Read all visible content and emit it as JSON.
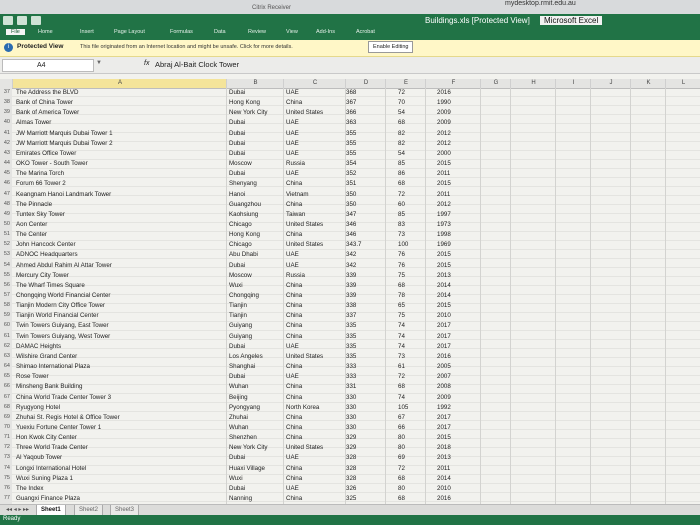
{
  "top_strip": {
    "url": "mydesktop.rmit.edu.au",
    "button": "Citrix Receiver"
  },
  "title_bar": {
    "title": "Buildings.xls [Protected View]",
    "app": "Microsoft Excel"
  },
  "ribbon_tabs": [
    "File",
    "Home",
    "Insert",
    "Page Layout",
    "Formulas",
    "Data",
    "Review",
    "View",
    "Add-Ins",
    "Acrobat"
  ],
  "protected_view": {
    "label": "Protected View",
    "message": "This file originated from an Internet location and might be unsafe. Click for more details.",
    "button": "Enable Editing"
  },
  "formula_bar": {
    "cell": "A4",
    "fx": "fx",
    "content": "Abraj Al-Bait Clock Tower"
  },
  "columns": [
    "A",
    "B",
    "C",
    "D",
    "E",
    "F",
    "G",
    "H",
    "I",
    "J",
    "K",
    "L"
  ],
  "rows": [
    {
      "n": "37",
      "name": "The Address the BLVD",
      "city": "Dubai",
      "country": "UAE",
      "height": "368",
      "floors": "72",
      "year": "2016"
    },
    {
      "n": "38",
      "name": "Bank of China Tower",
      "city": "Hong Kong",
      "country": "China",
      "height": "367",
      "floors": "70",
      "year": "1990"
    },
    {
      "n": "39",
      "name": "Bank of America Tower",
      "city": "New York City",
      "country": "United States",
      "height": "366",
      "floors": "54",
      "year": "2009"
    },
    {
      "n": "40",
      "name": "Almas Tower",
      "city": "Dubai",
      "country": "UAE",
      "height": "363",
      "floors": "68",
      "year": "2009"
    },
    {
      "n": "41",
      "name": "JW Marriott Marquis Dubai Tower 1",
      "city": "Dubai",
      "country": "UAE",
      "height": "355",
      "floors": "82",
      "year": "2012"
    },
    {
      "n": "42",
      "name": "JW Marriott Marquis Dubai Tower 2",
      "city": "Dubai",
      "country": "UAE",
      "height": "355",
      "floors": "82",
      "year": "2012"
    },
    {
      "n": "43",
      "name": "Emirates Office Tower",
      "city": "Dubai",
      "country": "UAE",
      "height": "355",
      "floors": "54",
      "year": "2000"
    },
    {
      "n": "44",
      "name": "OKO Tower - South Tower",
      "city": "Moscow",
      "country": "Russia",
      "height": "354",
      "floors": "85",
      "year": "2015"
    },
    {
      "n": "45",
      "name": "The Marina Torch",
      "city": "Dubai",
      "country": "UAE",
      "height": "352",
      "floors": "86",
      "year": "2011"
    },
    {
      "n": "46",
      "name": "Forum 66 Tower 2",
      "city": "Shenyang",
      "country": "China",
      "height": "351",
      "floors": "68",
      "year": "2015"
    },
    {
      "n": "47",
      "name": "Keangnam Hanoi Landmark Tower",
      "city": "Hanoi",
      "country": "Vietnam",
      "height": "350",
      "floors": "72",
      "year": "2011"
    },
    {
      "n": "48",
      "name": "The Pinnacle",
      "city": "Guangzhou",
      "country": "China",
      "height": "350",
      "floors": "60",
      "year": "2012"
    },
    {
      "n": "49",
      "name": "Tuntex Sky Tower",
      "city": "Kaohsiung",
      "country": "Taiwan",
      "height": "347",
      "floors": "85",
      "year": "1997"
    },
    {
      "n": "50",
      "name": "Aon Center",
      "city": "Chicago",
      "country": "United States",
      "height": "346",
      "floors": "83",
      "year": "1973"
    },
    {
      "n": "51",
      "name": "The Center",
      "city": "Hong Kong",
      "country": "China",
      "height": "346",
      "floors": "73",
      "year": "1998"
    },
    {
      "n": "52",
      "name": "John Hancock Center",
      "city": "Chicago",
      "country": "United States",
      "height": "343.7",
      "floors": "100",
      "year": "1969"
    },
    {
      "n": "53",
      "name": "ADNOC Headquarters",
      "city": "Abu Dhabi",
      "country": "UAE",
      "height": "342",
      "floors": "76",
      "year": "2015"
    },
    {
      "n": "54",
      "name": "Ahmed Abdul Rahim Al Attar Tower",
      "city": "Dubai",
      "country": "UAE",
      "height": "342",
      "floors": "76",
      "year": "2015"
    },
    {
      "n": "55",
      "name": "Mercury City Tower",
      "city": "Moscow",
      "country": "Russia",
      "height": "339",
      "floors": "75",
      "year": "2013"
    },
    {
      "n": "56",
      "name": "The Wharf Times Square",
      "city": "Wuxi",
      "country": "China",
      "height": "339",
      "floors": "68",
      "year": "2014"
    },
    {
      "n": "57",
      "name": "Chongqing World Financial Center",
      "city": "Chongqing",
      "country": "China",
      "height": "339",
      "floors": "78",
      "year": "2014"
    },
    {
      "n": "58",
      "name": "Tianjin Modern City Office Tower",
      "city": "Tianjin",
      "country": "China",
      "height": "338",
      "floors": "65",
      "year": "2015"
    },
    {
      "n": "59",
      "name": "Tianjin World Financial Center",
      "city": "Tianjin",
      "country": "China",
      "height": "337",
      "floors": "75",
      "year": "2010"
    },
    {
      "n": "60",
      "name": "Twin Towers Guiyang, East Tower",
      "city": "Guiyang",
      "country": "China",
      "height": "335",
      "floors": "74",
      "year": "2017"
    },
    {
      "n": "61",
      "name": "Twin Towers Guiyang, West Tower",
      "city": "Guiyang",
      "country": "China",
      "height": "335",
      "floors": "74",
      "year": "2017"
    },
    {
      "n": "62",
      "name": "DAMAC Heights",
      "city": "Dubai",
      "country": "UAE",
      "height": "335",
      "floors": "74",
      "year": "2017"
    },
    {
      "n": "63",
      "name": "Wilshire Grand Center",
      "city": "Los Angeles",
      "country": "United States",
      "height": "335",
      "floors": "73",
      "year": "2016"
    },
    {
      "n": "64",
      "name": "Shimao International Plaza",
      "city": "Shanghai",
      "country": "China",
      "height": "333",
      "floors": "61",
      "year": "2005"
    },
    {
      "n": "65",
      "name": "Rose Tower",
      "city": "Dubai",
      "country": "UAE",
      "height": "333",
      "floors": "72",
      "year": "2007"
    },
    {
      "n": "66",
      "name": "Minsheng Bank Building",
      "city": "Wuhan",
      "country": "China",
      "height": "331",
      "floors": "68",
      "year": "2008"
    },
    {
      "n": "67",
      "name": "China World Trade Center Tower 3",
      "city": "Beijing",
      "country": "China",
      "height": "330",
      "floors": "74",
      "year": "2009"
    },
    {
      "n": "68",
      "name": "Ryugyong Hotel",
      "city": "Pyongyang",
      "country": "North Korea",
      "height": "330",
      "floors": "105",
      "year": "1992"
    },
    {
      "n": "69",
      "name": "Zhuhai St. Regis Hotel & Office Tower",
      "city": "Zhuhai",
      "country": "China",
      "height": "330",
      "floors": "67",
      "year": "2017"
    },
    {
      "n": "70",
      "name": "Yuexiu Fortune Center Tower 1",
      "city": "Wuhan",
      "country": "China",
      "height": "330",
      "floors": "66",
      "year": "2017"
    },
    {
      "n": "71",
      "name": "Hon Kwok City Center",
      "city": "Shenzhen",
      "country": "China",
      "height": "329",
      "floors": "80",
      "year": "2015"
    },
    {
      "n": "72",
      "name": "Three World Trade Center",
      "city": "New York City",
      "country": "United States",
      "height": "329",
      "floors": "80",
      "year": "2018"
    },
    {
      "n": "73",
      "name": "Al Yaqoub Tower",
      "city": "Dubai",
      "country": "UAE",
      "height": "328",
      "floors": "69",
      "year": "2013"
    },
    {
      "n": "74",
      "name": "Longxi International Hotel",
      "city": "Huaxi Village",
      "country": "China",
      "height": "328",
      "floors": "72",
      "year": "2011"
    },
    {
      "n": "75",
      "name": "Wuxi Suning Plaza 1",
      "city": "Wuxi",
      "country": "China",
      "height": "328",
      "floors": "68",
      "year": "2014"
    },
    {
      "n": "76",
      "name": "The Index",
      "city": "Dubai",
      "country": "UAE",
      "height": "326",
      "floors": "80",
      "year": "2010"
    },
    {
      "n": "77",
      "name": "Guangxi Finance Plaza",
      "city": "Nanning",
      "country": "China",
      "height": "325",
      "floors": "68",
      "year": "2016"
    }
  ],
  "sheet_tabs": [
    "Sheet1",
    "Sheet2",
    "Sheet3"
  ],
  "status": "Ready",
  "colors": {
    "excel_green": "#217346",
    "warning_bar": "#fff7c7",
    "selection": "#fbf0b9"
  }
}
